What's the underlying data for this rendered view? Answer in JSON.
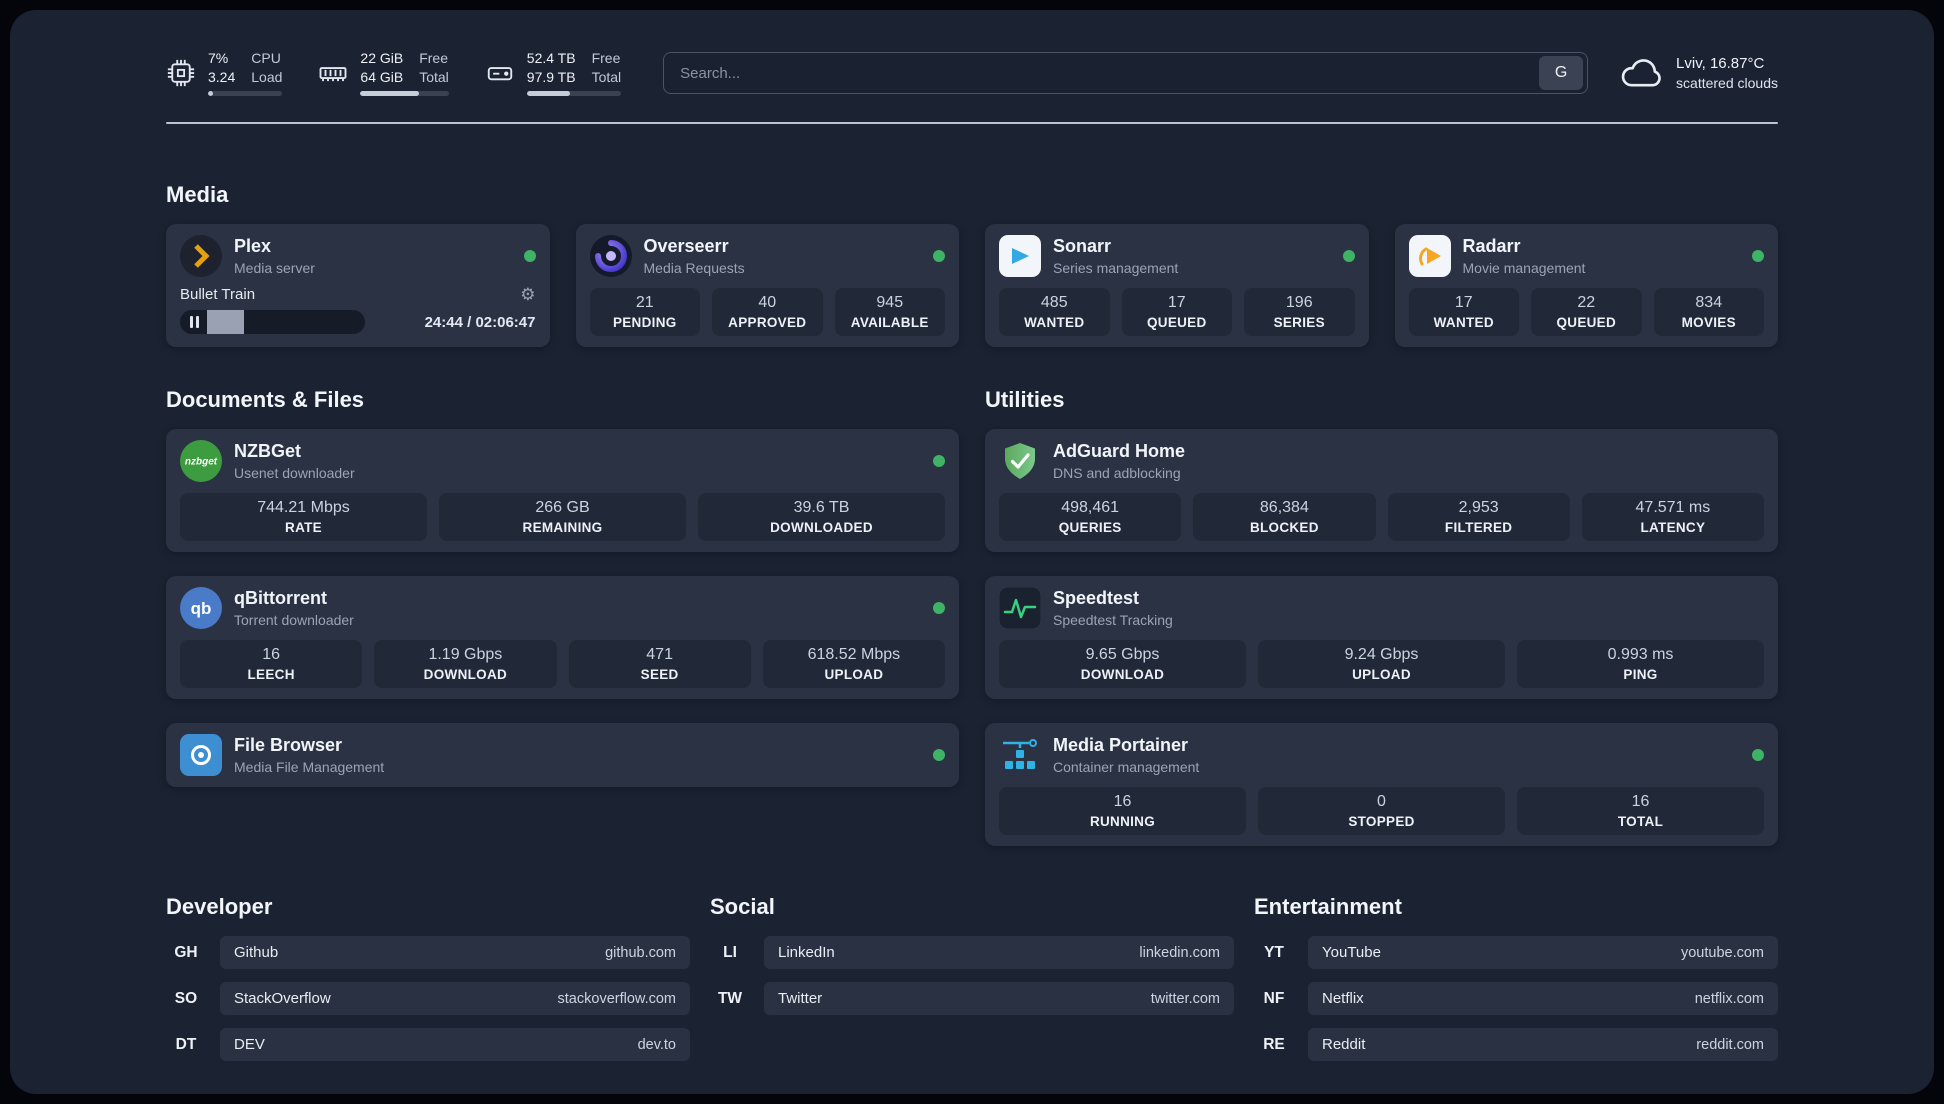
{
  "header": {
    "cpu": {
      "value": "7%",
      "load": "3.24",
      "label_top": "CPU",
      "label_bottom": "Load",
      "bar_percent": 7
    },
    "ram": {
      "free": "22 GiB",
      "total": "64 GiB",
      "label_top": "Free",
      "label_bottom": "Total",
      "bar_percent": 66
    },
    "disk": {
      "free": "52.4 TB",
      "total": "97.9 TB",
      "label_top": "Free",
      "label_bottom": "Total",
      "bar_percent": 46
    },
    "search": {
      "placeholder": "Search...",
      "button_label": "G"
    },
    "weather": {
      "location": "Lviv, 16.87°C",
      "condition": "scattered clouds"
    }
  },
  "sections": {
    "media": "Media",
    "documents": "Documents & Files",
    "utilities": "Utilities",
    "developer": "Developer",
    "social": "Social",
    "entertainment": "Entertainment"
  },
  "media": {
    "plex": {
      "name": "Plex",
      "subtitle": "Media server",
      "now_playing": "Bullet Train",
      "time": "24:44 / 02:06:47",
      "progress_percent": 20
    },
    "overseerr": {
      "name": "Overseerr",
      "subtitle": "Media Requests",
      "stats": [
        {
          "value": "21",
          "label": "PENDING"
        },
        {
          "value": "40",
          "label": "APPROVED"
        },
        {
          "value": "945",
          "label": "AVAILABLE"
        }
      ]
    },
    "sonarr": {
      "name": "Sonarr",
      "subtitle": "Series management",
      "stats": [
        {
          "value": "485",
          "label": "WANTED"
        },
        {
          "value": "17",
          "label": "QUEUED"
        },
        {
          "value": "196",
          "label": "SERIES"
        }
      ]
    },
    "radarr": {
      "name": "Radarr",
      "subtitle": "Movie management",
      "stats": [
        {
          "value": "17",
          "label": "WANTED"
        },
        {
          "value": "22",
          "label": "QUEUED"
        },
        {
          "value": "834",
          "label": "MOVIES"
        }
      ]
    }
  },
  "documents": {
    "nzbget": {
      "name": "NZBGet",
      "subtitle": "Usenet downloader",
      "icon_text": "nzbget",
      "stats": [
        {
          "value": "744.21 Mbps",
          "label": "RATE"
        },
        {
          "value": "266 GB",
          "label": "REMAINING"
        },
        {
          "value": "39.6 TB",
          "label": "DOWNLOADED"
        }
      ]
    },
    "qbittorrent": {
      "name": "qBittorrent",
      "subtitle": "Torrent downloader",
      "icon_text": "qb",
      "stats": [
        {
          "value": "16",
          "label": "LEECH"
        },
        {
          "value": "1.19 Gbps",
          "label": "DOWNLOAD"
        },
        {
          "value": "471",
          "label": "SEED"
        },
        {
          "value": "618.52 Mbps",
          "label": "UPLOAD"
        }
      ]
    },
    "filebrowser": {
      "name": "File Browser",
      "subtitle": "Media File Management"
    }
  },
  "utilities": {
    "adguard": {
      "name": "AdGuard Home",
      "subtitle": "DNS and adblocking",
      "stats": [
        {
          "value": "498,461",
          "label": "QUERIES"
        },
        {
          "value": "86,384",
          "label": "BLOCKED"
        },
        {
          "value": "2,953",
          "label": "FILTERED"
        },
        {
          "value": "47.571 ms",
          "label": "LATENCY"
        }
      ]
    },
    "speedtest": {
      "name": "Speedtest",
      "subtitle": "Speedtest Tracking",
      "stats": [
        {
          "value": "9.65 Gbps",
          "label": "DOWNLOAD"
        },
        {
          "value": "9.24 Gbps",
          "label": "UPLOAD"
        },
        {
          "value": "0.993 ms",
          "label": "PING"
        }
      ]
    },
    "portainer": {
      "name": "Media Portainer",
      "subtitle": "Container management",
      "stats": [
        {
          "value": "16",
          "label": "RUNNING"
        },
        {
          "value": "0",
          "label": "STOPPED"
        },
        {
          "value": "16",
          "label": "TOTAL"
        }
      ]
    }
  },
  "links": {
    "developer": [
      {
        "abbr": "GH",
        "name": "Github",
        "url": "github.com"
      },
      {
        "abbr": "SO",
        "name": "StackOverflow",
        "url": "stackoverflow.com"
      },
      {
        "abbr": "DT",
        "name": "DEV",
        "url": "dev.to"
      }
    ],
    "social": [
      {
        "abbr": "LI",
        "name": "LinkedIn",
        "url": "linkedin.com"
      },
      {
        "abbr": "TW",
        "name": "Twitter",
        "url": "twitter.com"
      }
    ],
    "entertainment": [
      {
        "abbr": "YT",
        "name": "YouTube",
        "url": "youtube.com"
      },
      {
        "abbr": "NF",
        "name": "Netflix",
        "url": "netflix.com"
      },
      {
        "abbr": "RE",
        "name": "Reddit",
        "url": "reddit.com"
      }
    ]
  }
}
